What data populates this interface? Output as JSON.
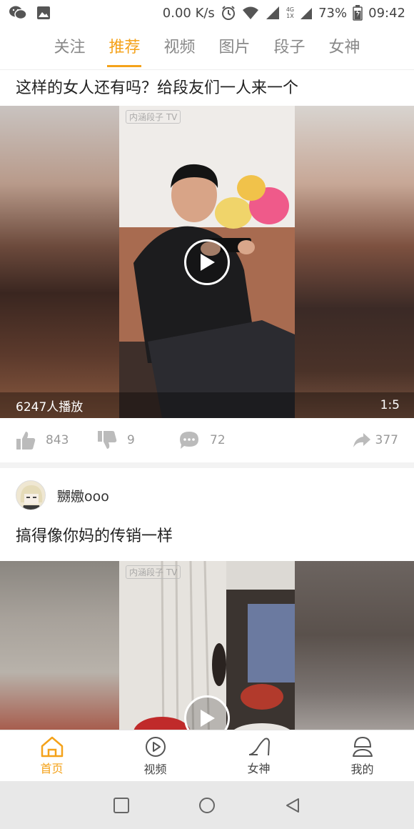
{
  "status_bar": {
    "net_speed": "0.00 K/s",
    "battery": "73%",
    "time": "09:42",
    "net_type": "4G",
    "sim": "1X",
    "icons": [
      "wechat-icon",
      "image-icon",
      "alarm-icon",
      "wifi-icon",
      "signal-icon",
      "battery-icon"
    ]
  },
  "top_tabs": [
    {
      "label": "关注",
      "active": false
    },
    {
      "label": "推荐",
      "active": true
    },
    {
      "label": "视频",
      "active": false
    },
    {
      "label": "图片",
      "active": false
    },
    {
      "label": "段子",
      "active": false
    },
    {
      "label": "女神",
      "active": false
    }
  ],
  "post1": {
    "title": "这样的女人还有吗？给段友们一人来一个",
    "watermark": "内涵段子 TV",
    "play_count": "6247人播放",
    "duration": "1:5",
    "likes": "843",
    "dislikes": "9",
    "comments": "72",
    "shares": "377"
  },
  "post2": {
    "username": "嬲嫐ooo",
    "title": "搞得像你妈的传销一样",
    "watermark": "内涵段子 TV"
  },
  "bottom_nav": [
    {
      "label": "首页",
      "icon": "home-icon",
      "active": true
    },
    {
      "label": "视频",
      "icon": "play-circle-icon",
      "active": false
    },
    {
      "label": "女神",
      "icon": "high-heel-icon",
      "active": false
    },
    {
      "label": "我的",
      "icon": "profile-icon",
      "active": false
    }
  ],
  "colors": {
    "accent": "#f4a21a",
    "text": "#222222",
    "muted": "#999999"
  }
}
